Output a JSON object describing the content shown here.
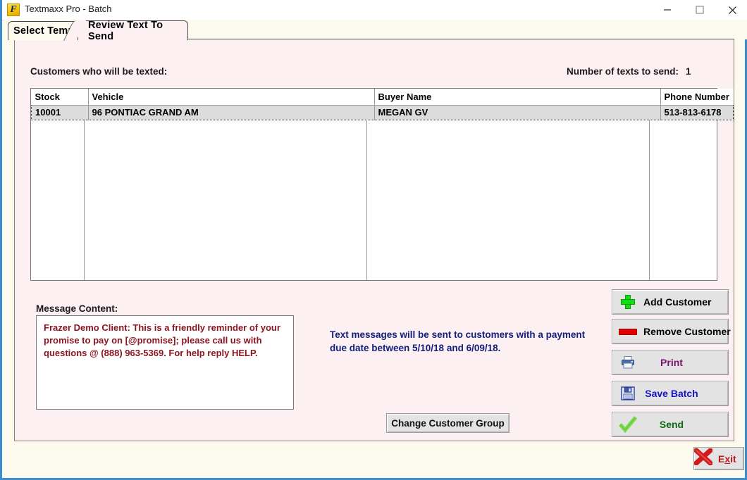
{
  "window": {
    "title": "Textmaxx Pro - Batch",
    "app_icon": "frazer-app-icon",
    "icon_letter": "F",
    "minimize_label": "Minimize",
    "maximize_label": "Maximize",
    "close_label": "Close"
  },
  "tabs": [
    {
      "id": "select-template",
      "label": "Select Template",
      "active": false
    },
    {
      "id": "review-text-to-send",
      "label": "Review Text To Send",
      "active": true
    }
  ],
  "main": {
    "customers_label": "Customers who will be texted:",
    "texts_to_send_label": "Number of texts to send:",
    "texts_to_send_value": "1",
    "message_content_label": "Message Content:",
    "message_content_value": "Frazer Demo Client: This is a friendly reminder of your promise to pay on [@promise]; please call us with questions @ (888) 963-5369. For help reply HELP.",
    "info_text": "Text messages will be sent to customers with a payment due date between 5/10/18 and 6/09/18.",
    "change_group_label": "Change Customer Group"
  },
  "grid": {
    "columns": [
      "Stock",
      "Vehicle",
      "Buyer Name",
      "Phone Number"
    ],
    "rows": [
      {
        "stock": "10001",
        "vehicle": "96 PONTIAC GRAND AM",
        "buyer": "MEGAN GV",
        "phone": "513-813-6178",
        "selected": true
      }
    ]
  },
  "actions": [
    {
      "id": "add-customer",
      "label": "Add Customer",
      "icon": "green-plus-icon",
      "color": "#000000"
    },
    {
      "id": "remove-customer",
      "label": "Remove Customer",
      "icon": "red-minus-icon",
      "color": "#000000"
    },
    {
      "id": "print",
      "label": "Print",
      "icon": "printer-icon",
      "color": "#7a0f6e"
    },
    {
      "id": "save-batch",
      "label": "Save Batch",
      "icon": "floppy-disk-icon",
      "color": "#1414c8"
    },
    {
      "id": "send",
      "label": "Send",
      "icon": "green-check-icon",
      "color": "#0e6b12"
    }
  ],
  "exit": {
    "label_prefix": "E",
    "label_accel": "x",
    "label_suffix": "it",
    "icon": "red-x-icon"
  },
  "colors": {
    "window_border": "#3c8ed0",
    "panel_background": "#fdf0f3",
    "frame_background": "#fdfbed",
    "message_text": "#8c1520",
    "info_text": "#12207a",
    "selected_row": "#dcdcdc"
  }
}
